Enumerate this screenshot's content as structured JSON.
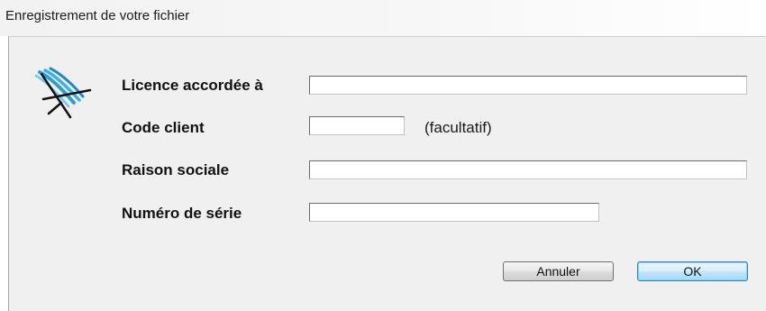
{
  "window": {
    "title": "Enregistrement de votre fichier"
  },
  "logo": {
    "icon": "deckchair-logo-icon",
    "accent": "#2a9fd6"
  },
  "form": {
    "licence_label": "Licence accordée à",
    "licence_value": "",
    "code_client_label": "Code client",
    "code_client_value": "",
    "code_client_hint": "(facultatif)",
    "raison_sociale_label": "Raison sociale",
    "raison_sociale_value": "",
    "numero_serie_label": "Numéro de série",
    "numero_serie_value": ""
  },
  "buttons": {
    "cancel_label": "Annuler",
    "ok_label": "OK"
  }
}
